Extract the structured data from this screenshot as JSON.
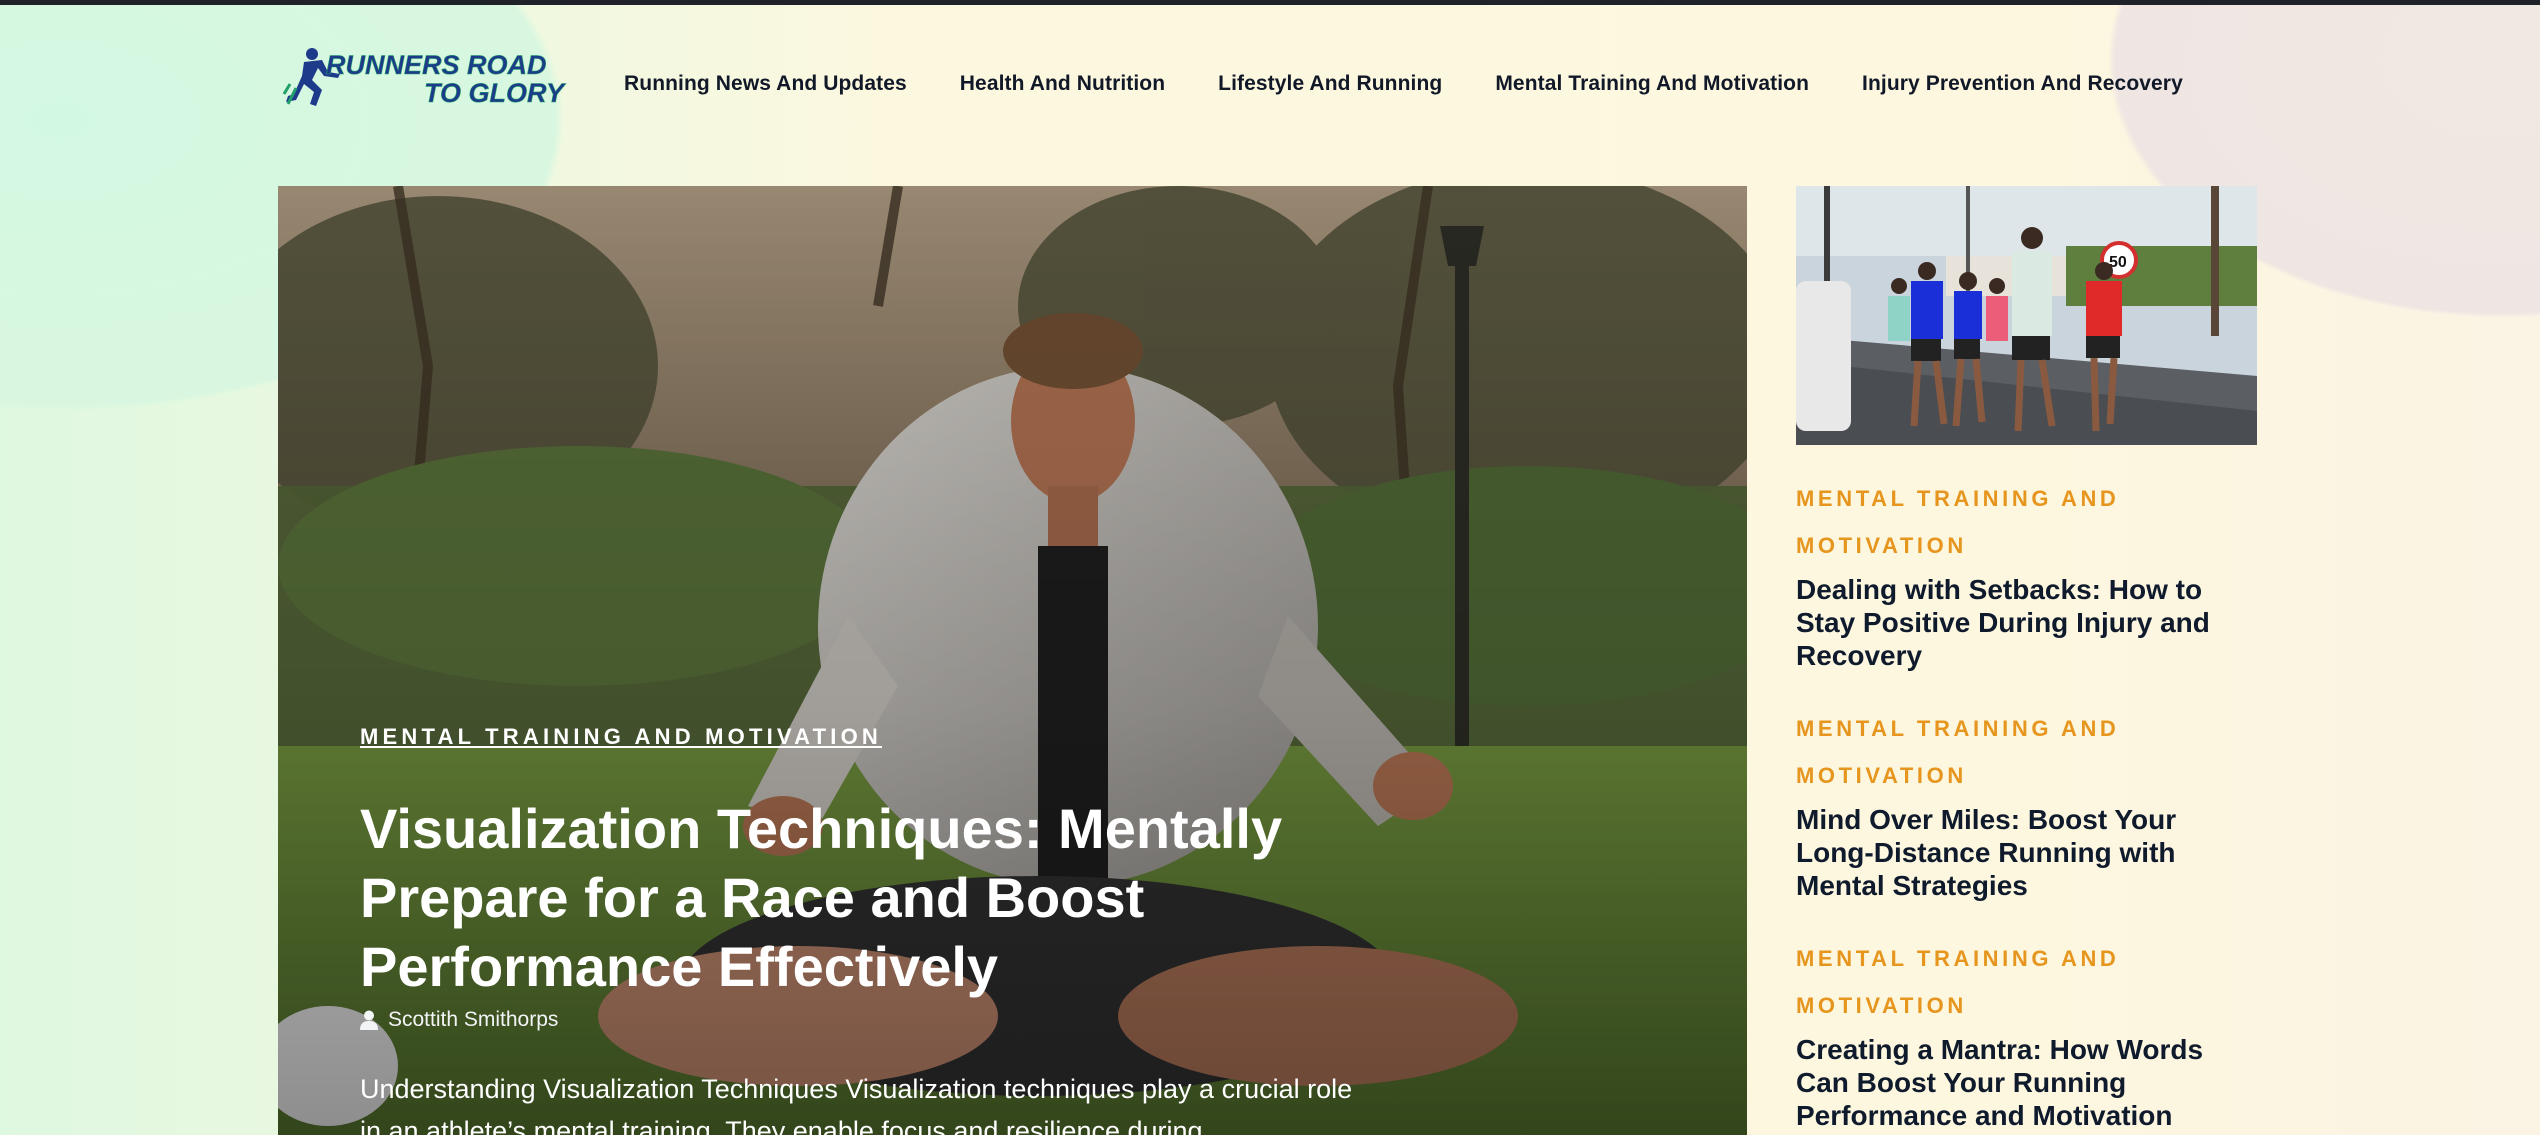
{
  "site": {
    "logo_text_line1": "RUNNERS ROAD",
    "logo_text_line2": "TO GLORY",
    "brand_colors": {
      "logo_blue": "#1e3a8a",
      "logo_green": "#22a06b",
      "accent_orange": "#e6961e"
    }
  },
  "nav": {
    "items": [
      {
        "label": "Running News And Updates"
      },
      {
        "label": "Health And Nutrition"
      },
      {
        "label": "Lifestyle And Running"
      },
      {
        "label": "Mental Training And Motivation"
      },
      {
        "label": "Injury Prevention And Recovery"
      }
    ]
  },
  "hero": {
    "category": "MENTAL TRAINING AND MOTIVATION",
    "title": "Visualization Techniques: Mentally Prepare for a Race and Boost Performance Effectively",
    "author": "Scottith Smithorps",
    "author_icon": "user-icon",
    "excerpt": "Understanding Visualization Techniques Visualization techniques play a crucial role in an athlete’s mental training. They enable focus and resilience during"
  },
  "sidebar": {
    "posts": [
      {
        "category": "MENTAL TRAINING AND MOTIVATION",
        "title": "Dealing with Setbacks: How to Stay Positive During Injury and Recovery"
      },
      {
        "category": "MENTAL TRAINING AND MOTIVATION",
        "title": "Mind Over Miles: Boost Your Long-Distance Running with Mental Strategies"
      },
      {
        "category": "MENTAL TRAINING AND MOTIVATION",
        "title": "Creating a Mantra: How Words Can Boost Your Running Performance and Motivation"
      }
    ]
  }
}
